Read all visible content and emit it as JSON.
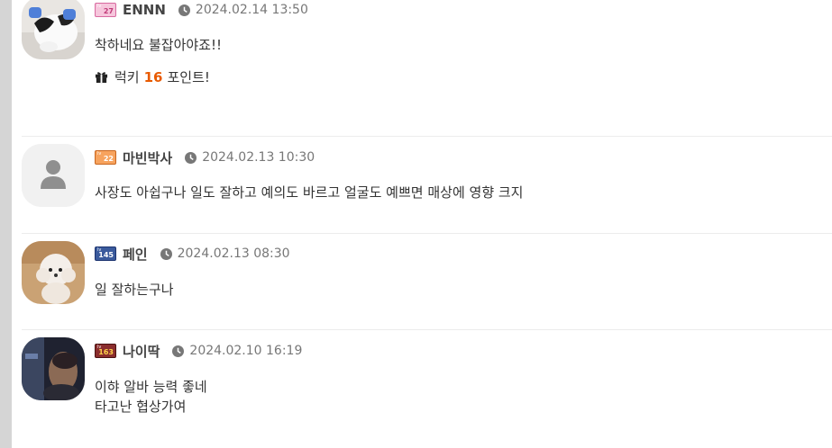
{
  "comments": [
    {
      "nickname": "ENNN",
      "level": "27",
      "level_tag": "lv",
      "date": "2024.02.14 13:50",
      "lines": [
        "착하네요 불잡아야죠!!"
      ],
      "lucky": {
        "prefix": "럭키",
        "points": "16",
        "suffix": "포인트!"
      },
      "avatar_icon": "cat-photo"
    },
    {
      "nickname": "마빈박사",
      "level": "22",
      "level_tag": "lv",
      "date": "2024.02.13 10:30",
      "lines": [
        "사장도 아쉽구나 일도 잘하고 예의도 바르고 얼굴도 예쁘면 매상에 영향 크지"
      ],
      "avatar_icon": "default-user-icon"
    },
    {
      "nickname": "페인",
      "level": "145",
      "level_tag": "lv",
      "date": "2024.02.13 08:30",
      "lines": [
        "일 잘하는구나"
      ],
      "avatar_icon": "dog-photo"
    },
    {
      "nickname": "나이딱",
      "level": "163",
      "level_tag": "lv",
      "date": "2024.02.10 16:19",
      "lines": [
        "이햐 알바 능력 좋네",
        "타고난 협상가여"
      ],
      "avatar_icon": "man-photo"
    }
  ],
  "colors": {
    "accent": "#e85a00",
    "divider": "#ececec",
    "sidebar": "#d5d5d5"
  }
}
